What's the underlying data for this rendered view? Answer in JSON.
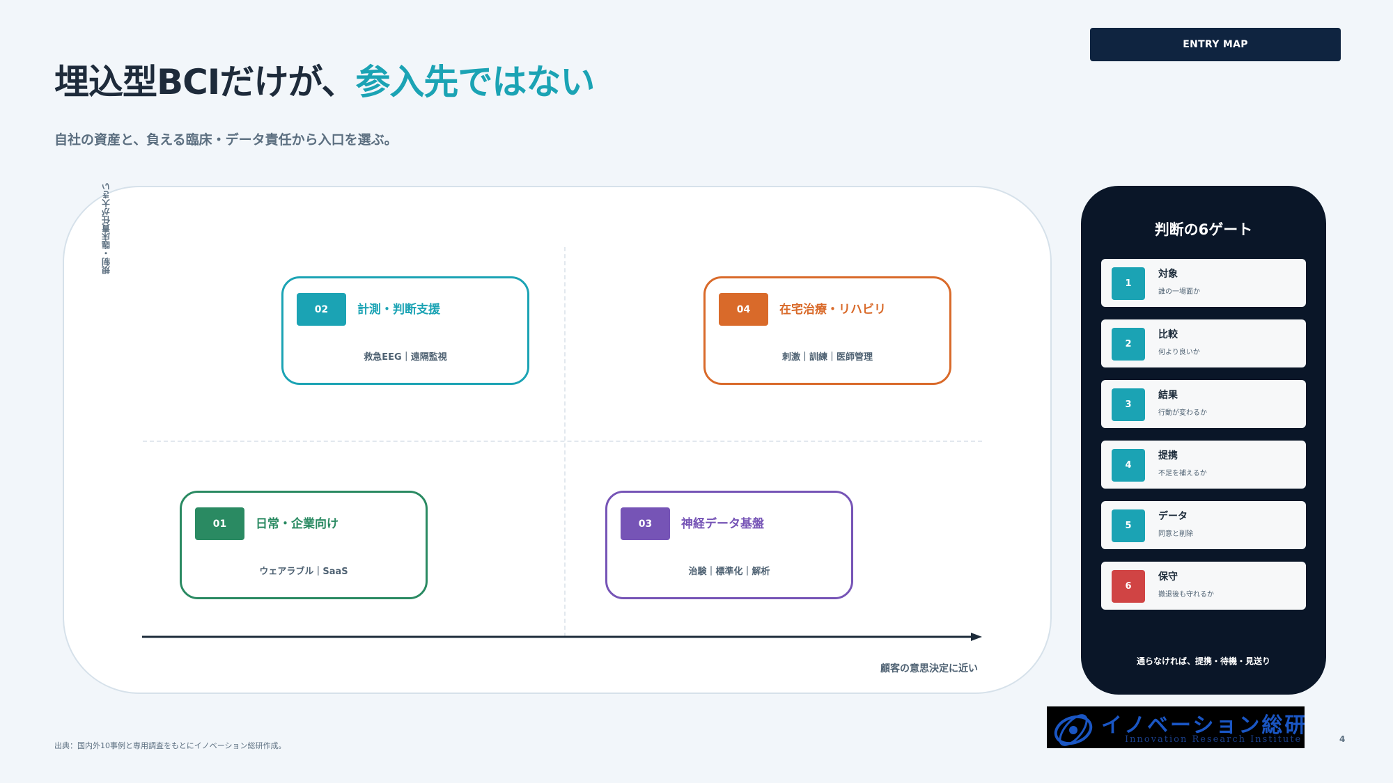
{
  "header": {
    "title_main": "埋込型BCIだけが、",
    "title_accent": "参入先ではない",
    "subtitle": "自社の資産と、負える臨床・データ責任から入口を選ぶ。",
    "entry_button": "ENTRY MAP"
  },
  "matrix": {
    "y_label": "規制・臨床責任が大きい",
    "x_label": "顧客の意思決定に近い",
    "quadrants": [
      {
        "id": "02",
        "title": "計測・判断支援",
        "sub": "救急EEG｜遠隔監視",
        "color": "#1ba3b4"
      },
      {
        "id": "04",
        "title": "在宅治療・リハビリ",
        "sub": "刺激｜訓練｜医師管理",
        "color": "#d96a2a"
      },
      {
        "id": "01",
        "title": "日常・企業向け",
        "sub": "ウェアラブル｜SaaS",
        "color": "#2a8a62"
      },
      {
        "id": "03",
        "title": "神経データ基盤",
        "sub": "治験｜標準化｜解析",
        "color": "#7654b6"
      }
    ]
  },
  "gates": {
    "title": "判断の6ゲート",
    "items": [
      {
        "num": "1",
        "name": "対象",
        "desc": "誰の一場面か"
      },
      {
        "num": "2",
        "name": "比較",
        "desc": "何より良いか"
      },
      {
        "num": "3",
        "name": "結果",
        "desc": "行動が変わるか"
      },
      {
        "num": "4",
        "name": "提携",
        "desc": "不足を補えるか"
      },
      {
        "num": "5",
        "name": "データ",
        "desc": "同意と削除"
      },
      {
        "num": "6",
        "name": "保守",
        "desc": "撤退後も守れるか"
      }
    ],
    "footer": "通らなければ、提携・待機・見送り",
    "accent_color": "#1ba3b4",
    "alert_color": "#d04444"
  },
  "footer": {
    "source": "出典：国内外10事例と専用調査をもとにイノベーション総研作成。",
    "page_number": "4"
  },
  "logo": {
    "jp": "イノベーション総研",
    "en": "Innovation Research Institute"
  }
}
